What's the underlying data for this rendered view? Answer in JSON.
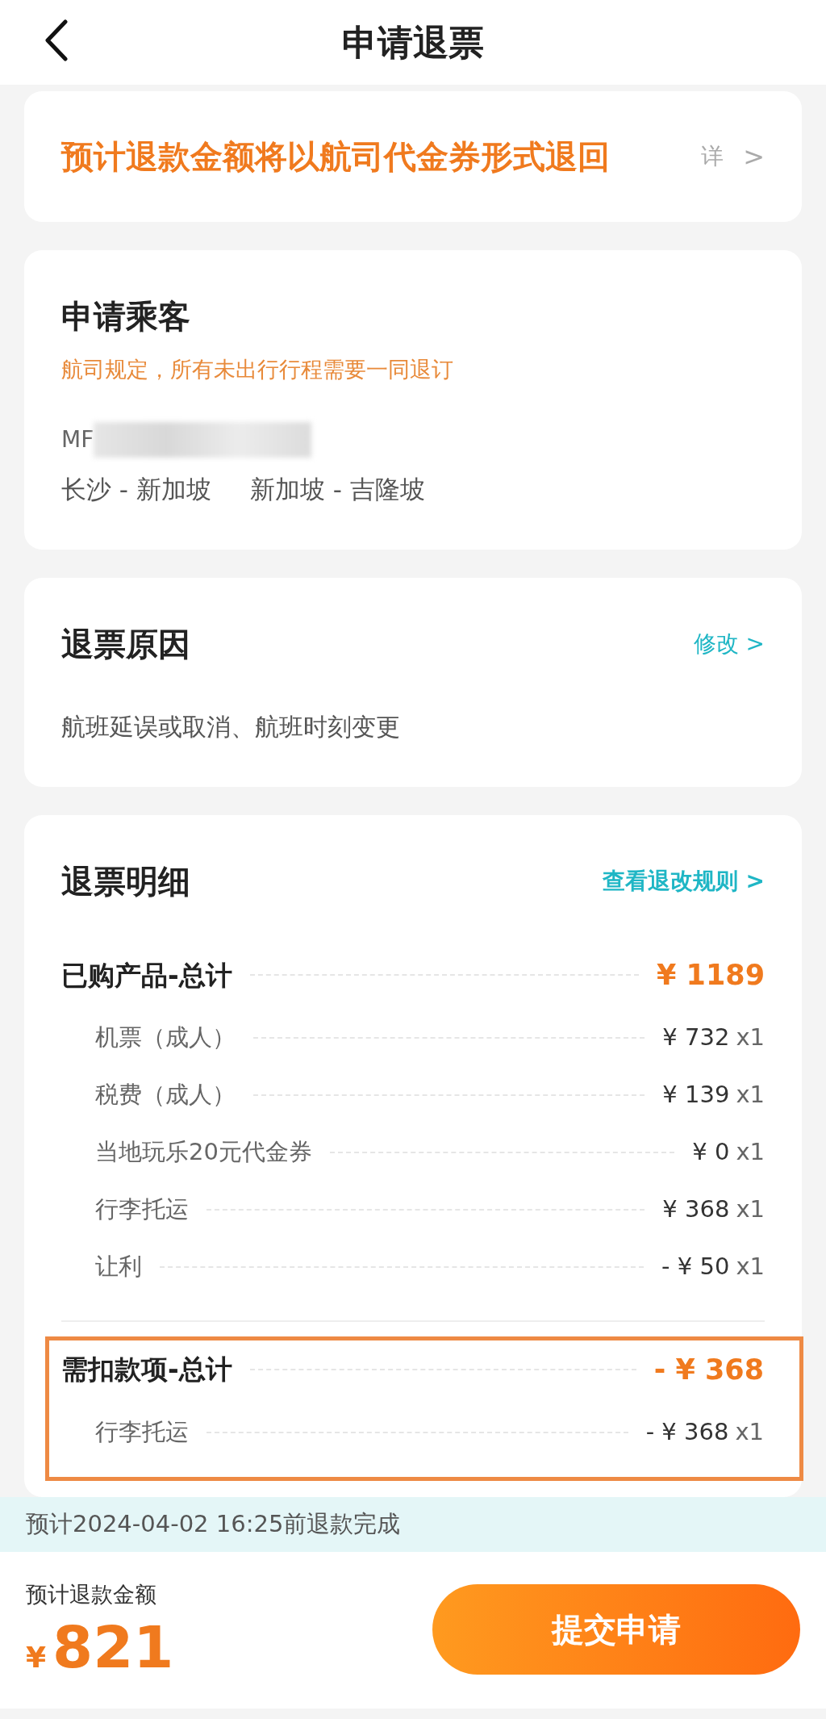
{
  "header": {
    "title": "申请退票"
  },
  "notice": {
    "text": "预计退款金额将以航司代金券形式退回",
    "link": "详",
    "arrow": ">"
  },
  "passengers": {
    "title": "申请乘客",
    "note": "航司规定，所有未出行行程需要一同退订",
    "name": "MF",
    "name_redacted": true,
    "routes": [
      "长沙 - 新加坡",
      "新加坡 - 吉隆坡"
    ]
  },
  "reason": {
    "title": "退票原因",
    "action": "修改 >",
    "text": "航班延误或取消、航班时刻变更"
  },
  "details": {
    "title": "退票明细",
    "action": "查看退改规则 >",
    "groups": [
      {
        "label": "已购产品-总计",
        "amount": "¥ 1189",
        "highlighted": false,
        "items": [
          {
            "label": "机票（成人）",
            "amount": "¥ 732",
            "qty": "x1"
          },
          {
            "label": "税费（成人）",
            "amount": "¥ 139",
            "qty": "x1"
          },
          {
            "label": "当地玩乐20元代金券",
            "amount": "¥ 0",
            "qty": "x1"
          },
          {
            "label": "行李托运",
            "amount": "¥ 368",
            "qty": "x1"
          },
          {
            "label": "让利",
            "amount": "- ¥ 50",
            "qty": "x1"
          }
        ]
      },
      {
        "label": "需扣款项-总计",
        "amount": "- ¥ 368",
        "highlighted": true,
        "items": [
          {
            "label": "行李托运",
            "amount": "- ¥ 368",
            "qty": "x1"
          }
        ]
      }
    ]
  },
  "eta": "预计2024-04-02 16:25前退款完成",
  "footer": {
    "label": "预计退款金额",
    "currency": "¥",
    "amount": "821",
    "button": "提交申请"
  }
}
